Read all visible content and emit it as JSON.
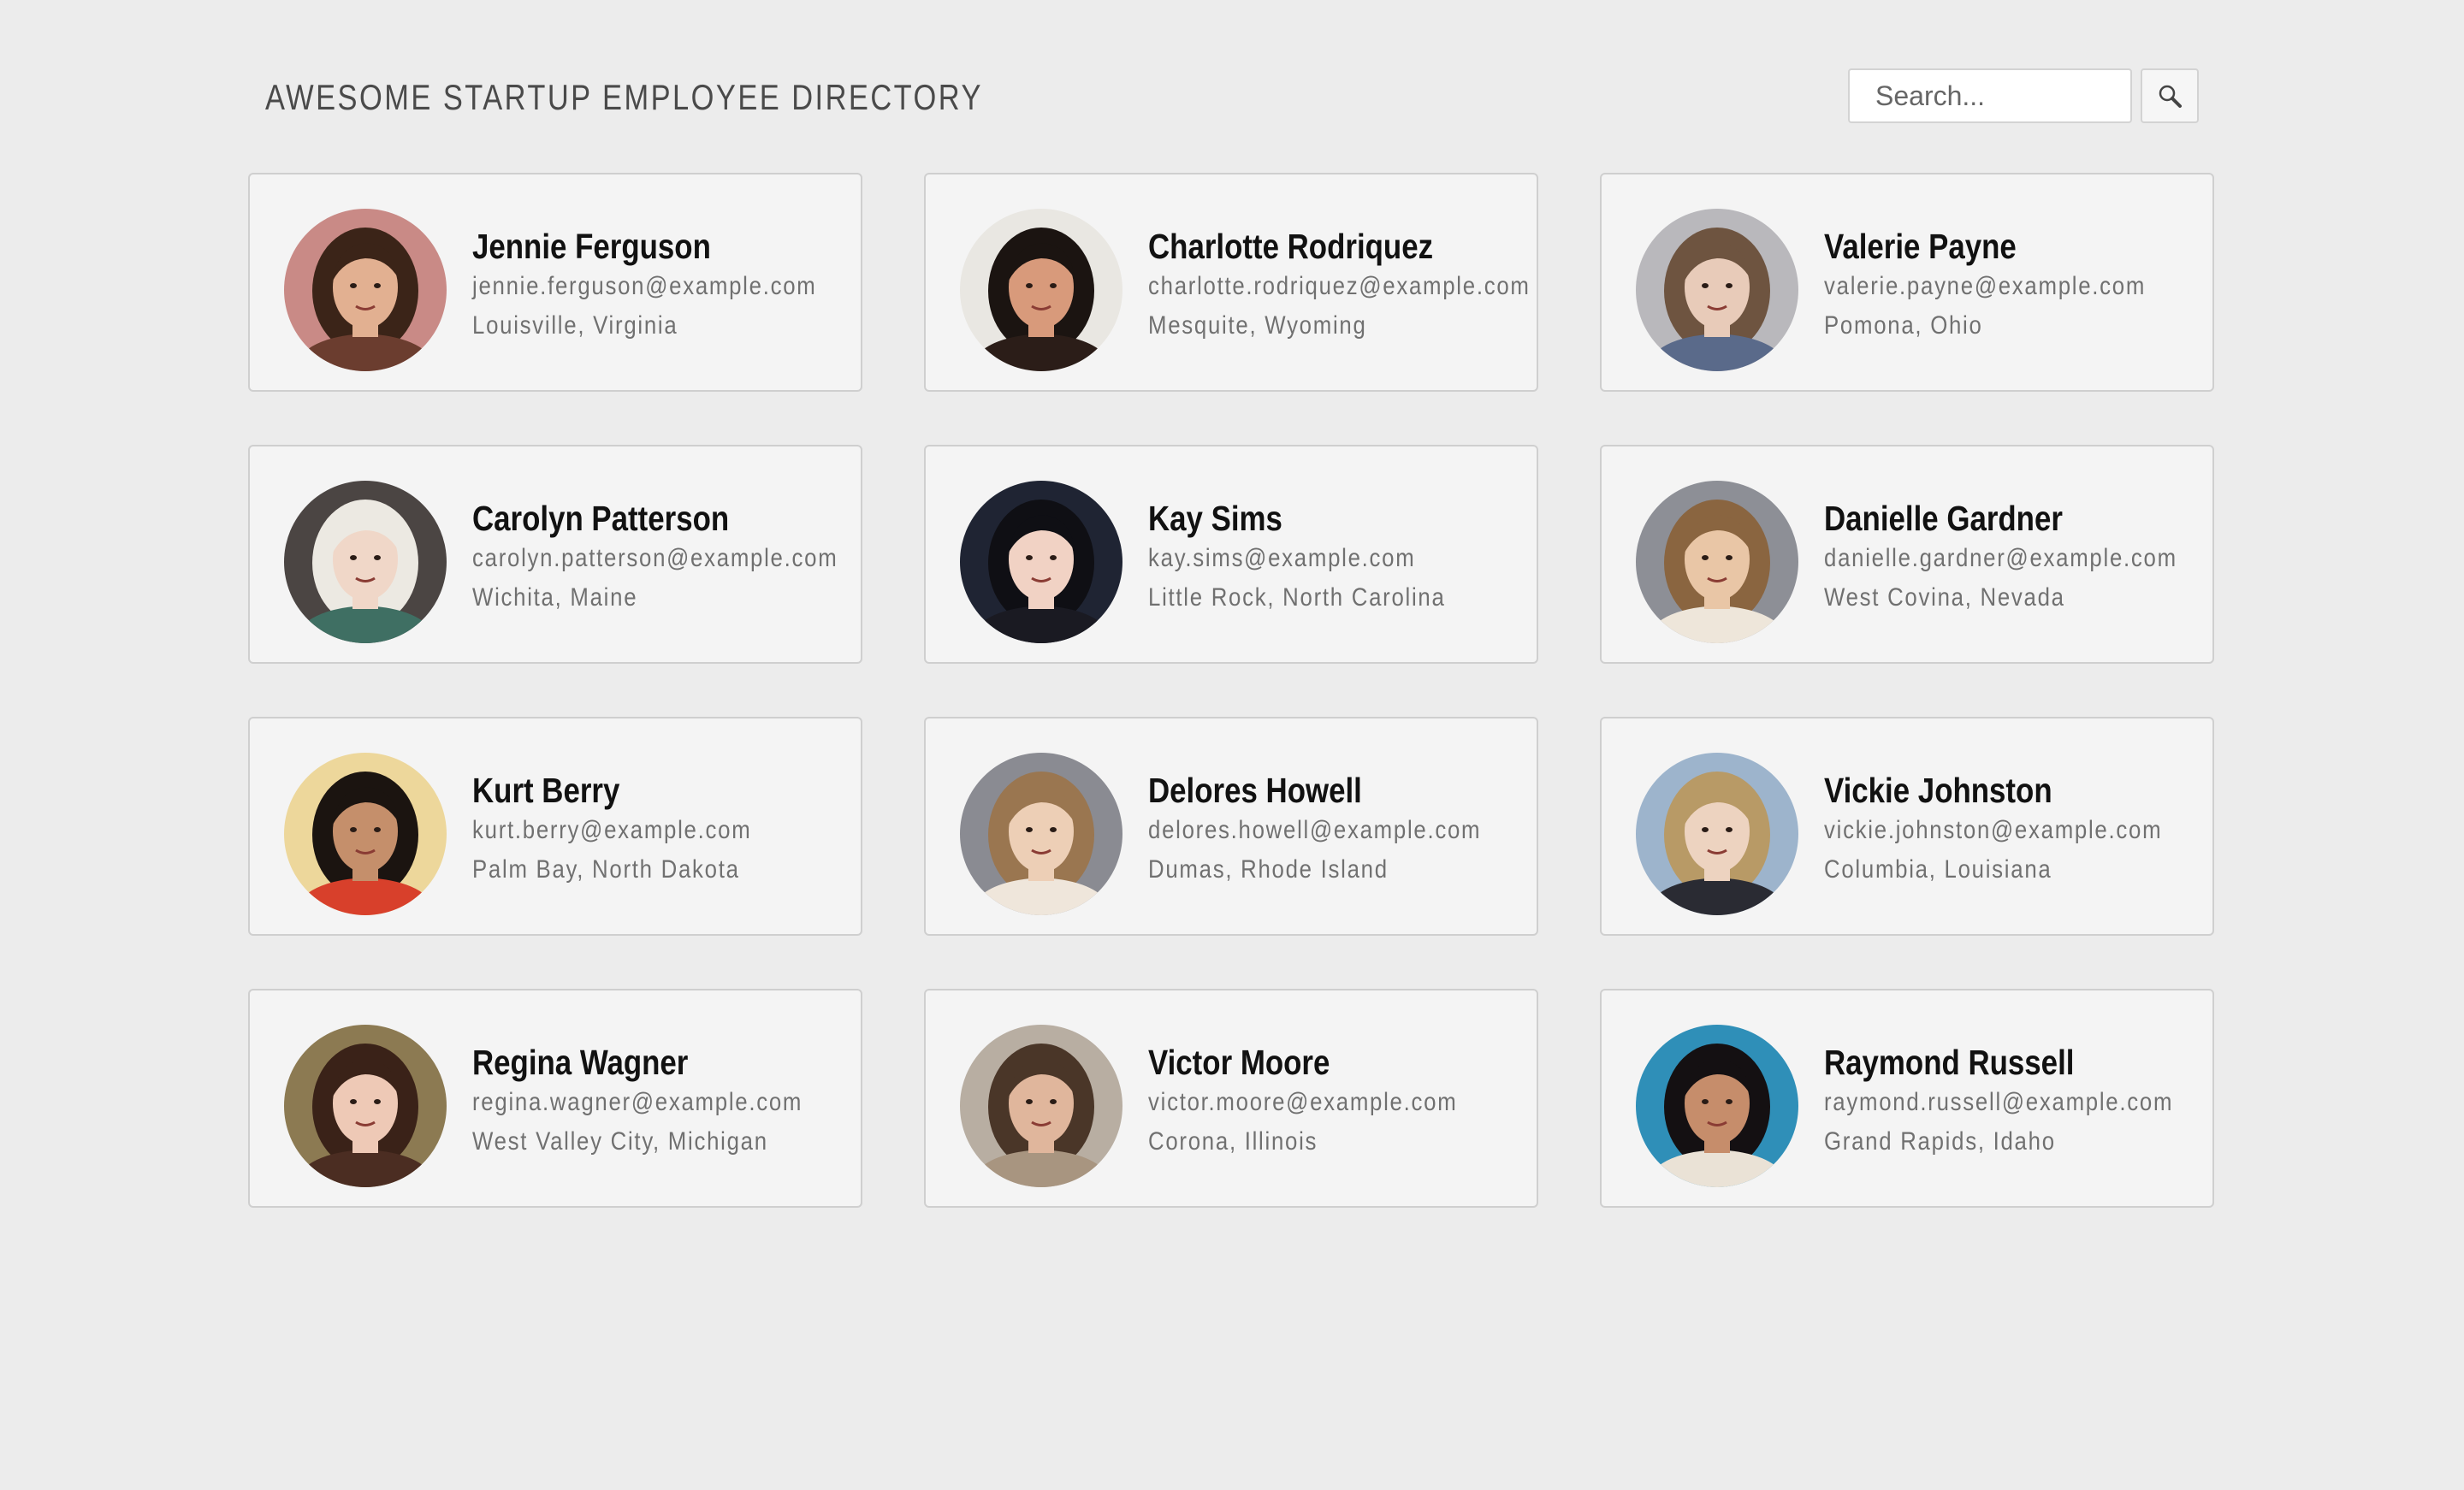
{
  "header": {
    "title": "Awesome Startup Employee Directory"
  },
  "search": {
    "placeholder": "Search...",
    "button_icon": "magnifier-icon"
  },
  "employees": [
    {
      "name": "Jennie Ferguson",
      "email": "jennie.ferguson@example.com",
      "location": "Louisville, Virginia",
      "avatar": {
        "bg": "#c98a86",
        "hair": "#3b2418",
        "skin": "#e2b091",
        "shirt": "#6b3d2f"
      }
    },
    {
      "name": "Charlotte Rodriquez",
      "email": "charlotte.rodriquez@example.com",
      "location": "Mesquite, Wyoming",
      "avatar": {
        "bg": "#e9e7e2",
        "hair": "#1b1411",
        "skin": "#d89a7b",
        "shirt": "#2b1d18"
      }
    },
    {
      "name": "Valerie Payne",
      "email": "valerie.payne@example.com",
      "location": "Pomona, Ohio",
      "avatar": {
        "bg": "#b9b8bc",
        "hair": "#6e5440",
        "skin": "#e8cbb9",
        "shirt": "#5a6a8a"
      }
    },
    {
      "name": "Carolyn Patterson",
      "email": "carolyn.patterson@example.com",
      "location": "Wichita, Maine",
      "avatar": {
        "bg": "#4b4543",
        "hair": "#ece9e2",
        "skin": "#f0d7c8",
        "shirt": "#3f6f63"
      }
    },
    {
      "name": "Kay Sims",
      "email": "kay.sims@example.com",
      "location": "Little Rock, North Carolina",
      "avatar": {
        "bg": "#1f2433",
        "hair": "#0f0f14",
        "skin": "#f1d2c4",
        "shirt": "#1a1a22"
      }
    },
    {
      "name": "Danielle Gardner",
      "email": "danielle.gardner@example.com",
      "location": "West Covina, Nevada",
      "avatar": {
        "bg": "#8d8f96",
        "hair": "#8a6540",
        "skin": "#e9c6a6",
        "shirt": "#eee6da"
      }
    },
    {
      "name": "Kurt Berry",
      "email": "kurt.berry@example.com",
      "location": "Palm Bay, North Dakota",
      "avatar": {
        "bg": "#edd79b",
        "hair": "#1b1410",
        "skin": "#c58f6b",
        "shirt": "#d8402b"
      }
    },
    {
      "name": "Delores Howell",
      "email": "delores.howell@example.com",
      "location": "Dumas, Rhode Island",
      "avatar": {
        "bg": "#8a8b92",
        "hair": "#9a7650",
        "skin": "#edcfb6",
        "shirt": "#efe6db"
      }
    },
    {
      "name": "Vickie Johnston",
      "email": "vickie.johnston@example.com",
      "location": "Columbia, Louisiana",
      "avatar": {
        "bg": "#9db4cc",
        "hair": "#b89a66",
        "skin": "#edd3c0",
        "shirt": "#2a2b33"
      }
    },
    {
      "name": "Regina Wagner",
      "email": "regina.wagner@example.com",
      "location": "West Valley City, Michigan",
      "avatar": {
        "bg": "#8c7a52",
        "hair": "#3a2218",
        "skin": "#eec9b6",
        "shirt": "#4b2d22"
      }
    },
    {
      "name": "Victor Moore",
      "email": "victor.moore@example.com",
      "location": "Corona, Illinois",
      "avatar": {
        "bg": "#b8aea2",
        "hair": "#4a3628",
        "skin": "#e0b69c",
        "shirt": "#a89580"
      }
    },
    {
      "name": "Raymond Russell",
      "email": "raymond.russell@example.com",
      "location": "Grand Rapids, Idaho",
      "avatar": {
        "bg": "#2f8fb8",
        "hair": "#141012",
        "skin": "#c68d6b",
        "shirt": "#eae2d6"
      }
    }
  ]
}
